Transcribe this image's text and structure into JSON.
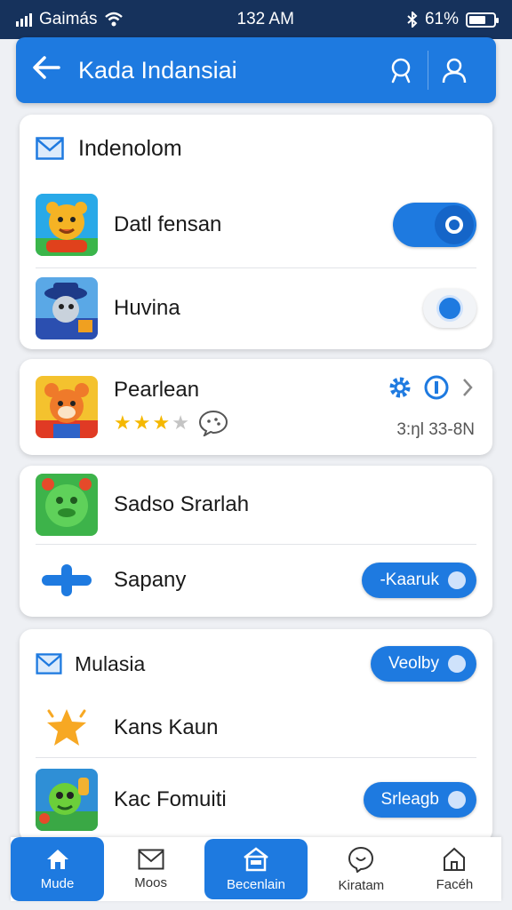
{
  "status": {
    "carrier": "Gaimás",
    "time": "132 AM",
    "battery": "61%"
  },
  "header": {
    "title": "Kada Indansiai"
  },
  "card1": {
    "title": "Indenolom",
    "rows": [
      {
        "label": "Datl fensan",
        "toggle_on": true
      },
      {
        "label": "Huvina"
      }
    ]
  },
  "card2": {
    "title": "Pearlean",
    "rating": 3,
    "rating_max": 4,
    "meta": "3:ŋl 33-8N"
  },
  "card3": {
    "rows": [
      {
        "label": "Sadso Srarlah"
      },
      {
        "label": "Sapany",
        "button": "-Kaaruk"
      }
    ]
  },
  "card4": {
    "title": "Mulasia",
    "button": "Veolby",
    "rows": [
      {
        "label": "Kans Kaun"
      },
      {
        "label": "Kac Fomuiti",
        "button": "Srleagb"
      }
    ]
  },
  "nav": {
    "items": [
      {
        "label": "Mude"
      },
      {
        "label": "Moos"
      },
      {
        "label": "Becenlain"
      },
      {
        "label": "Kiratam"
      },
      {
        "label": "Facéh"
      }
    ]
  },
  "colors": {
    "primary": "#1e7ae0",
    "status_bar": "#16325c",
    "star": "#f5b800"
  }
}
